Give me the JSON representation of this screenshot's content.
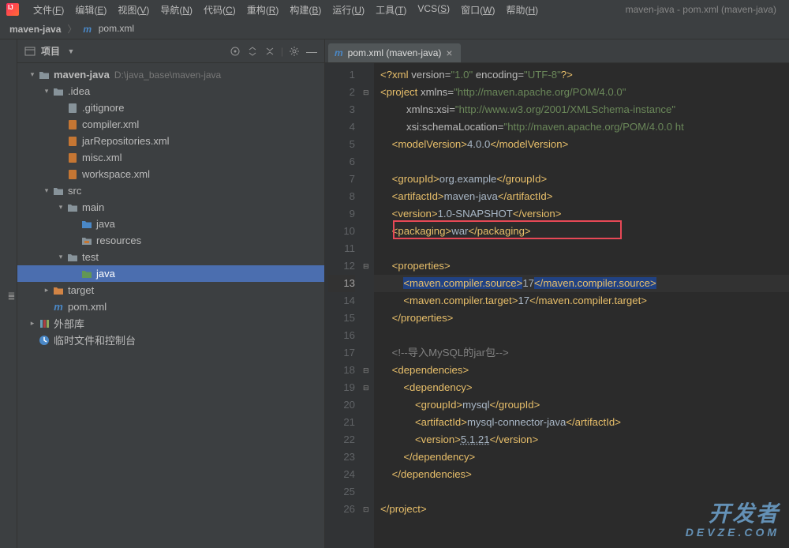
{
  "window": {
    "title": "maven-java - pom.xml (maven-java)"
  },
  "menu": {
    "items": [
      "文件(F)",
      "编辑(E)",
      "视图(V)",
      "导航(N)",
      "代码(C)",
      "重构(R)",
      "构建(B)",
      "运行(U)",
      "工具(T)",
      "VCS(S)",
      "窗口(W)",
      "帮助(H)"
    ]
  },
  "breadcrumb": {
    "root": "maven-java",
    "file": "pom.xml"
  },
  "project_panel": {
    "title": "项目",
    "tree": [
      {
        "depth": 0,
        "arrow": "▾",
        "icon": "folder",
        "label": "maven-java",
        "hint": "D:\\java_base\\maven-java",
        "bold": true
      },
      {
        "depth": 1,
        "arrow": "▾",
        "icon": "folder",
        "label": ".idea"
      },
      {
        "depth": 2,
        "arrow": "",
        "icon": "file-git",
        "label": ".gitignore"
      },
      {
        "depth": 2,
        "arrow": "",
        "icon": "file-xml",
        "label": "compiler.xml"
      },
      {
        "depth": 2,
        "arrow": "",
        "icon": "file-xml",
        "label": "jarRepositories.xml"
      },
      {
        "depth": 2,
        "arrow": "",
        "icon": "file-xml",
        "label": "misc.xml"
      },
      {
        "depth": 2,
        "arrow": "",
        "icon": "file-xml",
        "label": "workspace.xml"
      },
      {
        "depth": 1,
        "arrow": "▾",
        "icon": "folder",
        "label": "src"
      },
      {
        "depth": 2,
        "arrow": "▾",
        "icon": "folder",
        "label": "main"
      },
      {
        "depth": 3,
        "arrow": "",
        "icon": "folder-blue",
        "label": "java"
      },
      {
        "depth": 3,
        "arrow": "",
        "icon": "folder-res",
        "label": "resources"
      },
      {
        "depth": 2,
        "arrow": "▾",
        "icon": "folder",
        "label": "test"
      },
      {
        "depth": 3,
        "arrow": "",
        "icon": "folder-green",
        "label": "java",
        "selected": true
      },
      {
        "depth": 1,
        "arrow": "▸",
        "icon": "folder-orange",
        "label": "target"
      },
      {
        "depth": 1,
        "arrow": "",
        "icon": "file-m",
        "label": "pom.xml"
      },
      {
        "depth": 0,
        "arrow": "▸",
        "icon": "lib",
        "label": "外部库"
      },
      {
        "depth": 0,
        "arrow": "",
        "icon": "scratch",
        "label": "临时文件和控制台"
      }
    ]
  },
  "editor": {
    "tab_label": "pom.xml (maven-java)",
    "lines": 26,
    "code_lines": [
      {
        "n": 1,
        "html": "<span class='t-tag'>&lt;?xml</span> <span class='t-attr'>version=</span><span class='t-str'>\"1.0\"</span> <span class='t-attr'>encoding=</span><span class='t-str'>\"UTF-8\"</span><span class='t-tag'>?&gt;</span>",
        "indent": 0
      },
      {
        "n": 2,
        "html": "<span class='t-tag'>&lt;project</span> <span class='t-attr'>xmlns=</span><span class='t-str'>\"http://maven.apache.org/POM/4.0.0\"</span>",
        "indent": 0,
        "fold": "⊟"
      },
      {
        "n": 3,
        "html": "         <span class='t-attr'>xmlns:xsi=</span><span class='t-str'>\"http://www.w3.org/2001/XMLSchema-instance\"</span>",
        "indent": 0
      },
      {
        "n": 4,
        "html": "         <span class='t-attr'>xsi:schemaLocation=</span><span class='t-str'>\"http://maven.apache.org/POM/4.0.0 ht</span>",
        "indent": 0
      },
      {
        "n": 5,
        "html": "    <span class='t-tag'>&lt;modelVersion&gt;</span><span class='t-text'>4.0.0</span><span class='t-tag'>&lt;/modelVersion&gt;</span>",
        "indent": 0
      },
      {
        "n": 6,
        "html": "",
        "indent": 0
      },
      {
        "n": 7,
        "html": "    <span class='t-tag'>&lt;groupId&gt;</span><span class='t-text'>org.example</span><span class='t-tag'>&lt;/groupId&gt;</span>",
        "indent": 0
      },
      {
        "n": 8,
        "html": "    <span class='t-tag'>&lt;artifactId&gt;</span><span class='t-text'>maven-java</span><span class='t-tag'>&lt;/artifactId&gt;</span>",
        "indent": 0
      },
      {
        "n": 9,
        "html": "    <span class='t-tag'>&lt;version&gt;</span><span class='t-text'>1.0-SNAPSHOT</span><span class='t-tag'>&lt;/version&gt;</span>",
        "indent": 0
      },
      {
        "n": 10,
        "html": "    <span class='t-tag'>&lt;packaging&gt;</span><span class='t-text'>war</span><span class='t-tag'>&lt;/packaging&gt;</span>",
        "indent": 0,
        "redbox": true
      },
      {
        "n": 11,
        "html": "",
        "indent": 0
      },
      {
        "n": 12,
        "html": "    <span class='t-tag'>&lt;properties&gt;</span>",
        "indent": 0,
        "fold": "⊟"
      },
      {
        "n": 13,
        "html": "        <span class='t-hl'>&lt;maven.compiler.source&gt;</span><span class='t-text'>17</span><span class='t-hl'>&lt;/maven.compiler.source&gt;</span>",
        "indent": 0,
        "current": true,
        "bulb": true
      },
      {
        "n": 14,
        "html": "        <span class='t-tag'>&lt;maven.compiler.target&gt;</span><span class='t-text'>17</span><span class='t-tag'>&lt;/maven.compiler.target&gt;</span>",
        "indent": 0
      },
      {
        "n": 15,
        "html": "    <span class='t-tag'>&lt;/properties&gt;</span>",
        "indent": 0
      },
      {
        "n": 16,
        "html": "",
        "indent": 0
      },
      {
        "n": 17,
        "html": "    <span class='t-comment'>&lt;!--导入MySQL的jar包--&gt;</span>",
        "indent": 0
      },
      {
        "n": 18,
        "html": "    <span class='t-tag'>&lt;dependencies&gt;</span>",
        "indent": 0,
        "fold": "⊟"
      },
      {
        "n": 19,
        "html": "        <span class='t-tag'>&lt;dependency&gt;</span>",
        "indent": 0,
        "fold": "⊟"
      },
      {
        "n": 20,
        "html": "            <span class='t-tag'>&lt;groupId&gt;</span><span class='t-text'>mysql</span><span class='t-tag'>&lt;/groupId&gt;</span>",
        "indent": 0
      },
      {
        "n": 21,
        "html": "            <span class='t-tag'>&lt;artifactId&gt;</span><span class='t-text'>mysql-connector-java</span><span class='t-tag'>&lt;/artifactId&gt;</span>",
        "indent": 0
      },
      {
        "n": 22,
        "html": "            <span class='t-tag'>&lt;version&gt;</span><span class='t-text' style='text-decoration:underline dotted'>5.1.21</span><span class='t-tag'>&lt;/version&gt;</span>",
        "indent": 0
      },
      {
        "n": 23,
        "html": "        <span class='t-tag'>&lt;/dependency&gt;</span>",
        "indent": 0
      },
      {
        "n": 24,
        "html": "    <span class='t-tag'>&lt;/dependencies&gt;</span>",
        "indent": 0
      },
      {
        "n": 25,
        "html": "",
        "indent": 0
      },
      {
        "n": 26,
        "html": "<span class='t-tag'>&lt;/project&gt;</span>",
        "indent": 0,
        "fold": "⊡"
      }
    ]
  },
  "watermark": {
    "line1": "开发者",
    "line2": "DEVZE.COM"
  }
}
